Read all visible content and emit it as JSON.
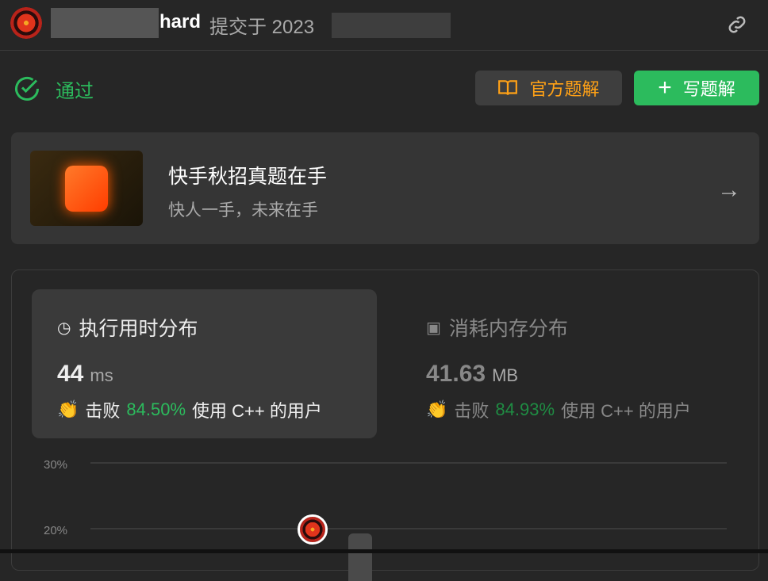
{
  "header": {
    "username": "hard",
    "submitted": "提交于 2023"
  },
  "status": {
    "label": "通过"
  },
  "buttons": {
    "official": "官方题解",
    "write": "写题解"
  },
  "banner": {
    "title": "快手秋招真题在手",
    "subtitle": "快人一手，未来在手"
  },
  "runtime": {
    "title": "执行用时分布",
    "value": "44",
    "unit": "ms",
    "beat": "击败",
    "percent": "84.50%",
    "suffix": "使用 C++ 的用户"
  },
  "memory": {
    "title": "消耗内存分布",
    "value": "41.63",
    "unit": "MB",
    "beat": "击败",
    "percent": "84.93%",
    "suffix": "使用 C++ 的用户"
  },
  "chart": {
    "ticks": [
      "30%",
      "20%"
    ]
  },
  "colors": {
    "accent_green": "#2cbb5d",
    "accent_orange": "#ffa116"
  }
}
